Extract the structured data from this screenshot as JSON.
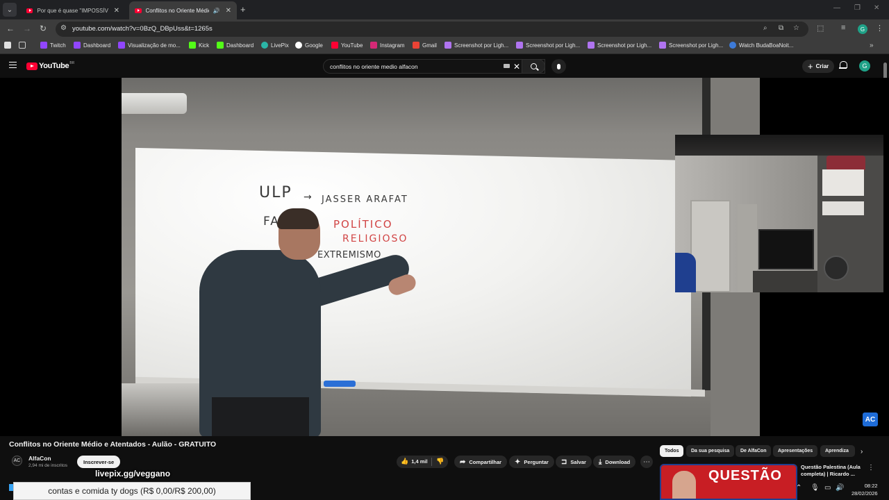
{
  "browser": {
    "tabs": [
      {
        "title": "Por que é quase \"IMPOSSÍVEL\"",
        "active": false
      },
      {
        "title": "Conflitos no Oriente Médio",
        "active": true
      }
    ],
    "url": "youtube.com/watch?v=0BzQ_DBpUss&t=1265s"
  },
  "bookmarks": [
    {
      "label": "Twitch",
      "color": "#9146ff"
    },
    {
      "label": "Dashboard",
      "color": "#9146ff"
    },
    {
      "label": "Visualização de mo...",
      "color": "#9146ff"
    },
    {
      "label": "Kick",
      "color": "#53fc18"
    },
    {
      "label": "Dashboard",
      "color": "#53fc18"
    },
    {
      "label": "LivePix",
      "color": "#2bb5a6"
    },
    {
      "label": "Google",
      "color": "#4285f4"
    },
    {
      "label": "YouTube",
      "color": "#ff0033"
    },
    {
      "label": "Instagram",
      "color": "#d62976"
    },
    {
      "label": "Gmail",
      "color": "#ea4335"
    },
    {
      "label": "Screenshot por Ligh...",
      "color": "#b074f0"
    },
    {
      "label": "Screenshot por Ligh...",
      "color": "#b074f0"
    },
    {
      "label": "Screenshot por Ligh...",
      "color": "#b074f0"
    },
    {
      "label": "Screenshot por Ligh...",
      "color": "#b074f0"
    },
    {
      "label": "Watch BudaBoaNoit...",
      "color": "#3d7bd9"
    }
  ],
  "youtube": {
    "logo": "YouTube",
    "logo_region": "BR",
    "search_query": "conflitos no oriente medio alfacon",
    "create_label": "Criar",
    "avatar_letter": "G"
  },
  "video": {
    "whiteboard": {
      "line1_left": "ULP",
      "line1_right": "JASSER ARAFAT",
      "line2_left": "FA",
      "line2_red1": "POLÍTICO",
      "line2_red2": "RELIGIOSO",
      "line3": "EXTREMISMO"
    },
    "channel_watermark": "AC",
    "title": "Conflitos no Oriente Médio e Atentados - Aulão - GRATUITO",
    "channel": {
      "name": "AlfaCon",
      "subscribers": "2,94 mi de inscritos",
      "avatar_text": "AC"
    },
    "subscribe_label": "Inscrever-se",
    "likes": "1,4 mil",
    "actions": {
      "share": "Compartilhar",
      "ask": "Perguntar",
      "save": "Salvar",
      "download": "Download"
    }
  },
  "chips": [
    "Todos",
    "Da sua pesquisa",
    "De AlfaCon",
    "Apresentações",
    "Aprendiza"
  ],
  "recommendation": {
    "thumb_text": "QUESTÃO",
    "title": "Questão Palestina (Aula completa) | Ricardo ..."
  },
  "overlay": {
    "livepix": "livepix.gg/veggano",
    "donation_text": "contas e comida ty dogs (R$ 0,00/R$ 200,00)",
    "donation_progress": 0.0
  },
  "taskbar": {
    "time": "08:22",
    "date": "28/02/2026"
  }
}
